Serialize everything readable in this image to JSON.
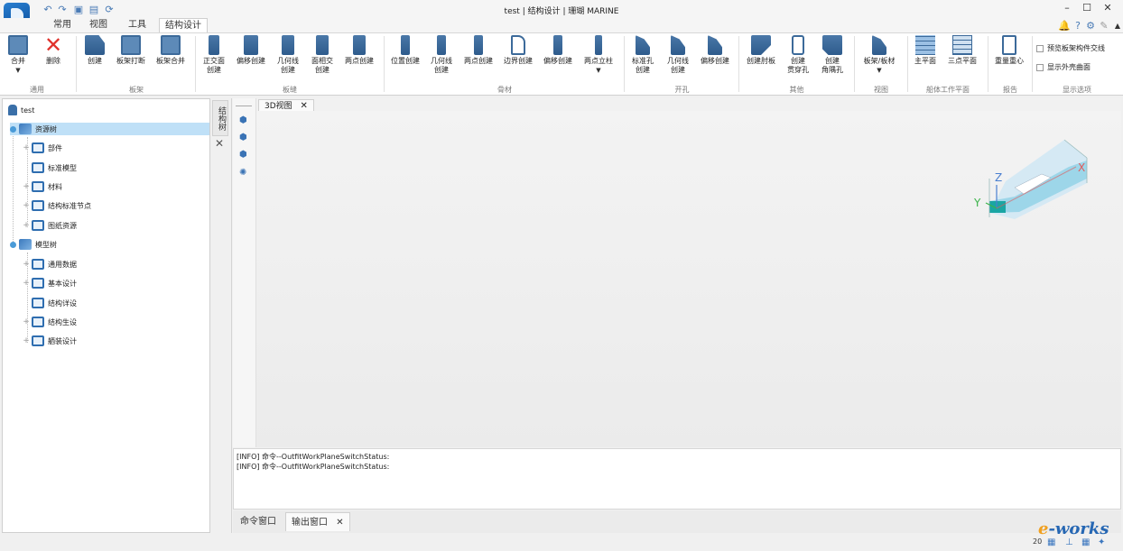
{
  "app": {
    "window_title": "test | 结构设计 | 珊瑚 MARINE"
  },
  "menu_tabs": [
    {
      "label": "常用"
    },
    {
      "label": "视图"
    },
    {
      "label": "工具"
    },
    {
      "label": "结构设计"
    }
  ],
  "ribbon": {
    "buttons": [
      {
        "label": "合并",
        "icon": "merge-icon",
        "dropdown": true
      },
      {
        "label": "删除",
        "icon": "delete-icon"
      },
      {
        "label": "创建",
        "icon": "create-panel-icon"
      },
      {
        "label": "板架打断",
        "icon": "panel-break-icon"
      },
      {
        "label": "板架合并",
        "icon": "panel-merge-icon"
      },
      {
        "label": "正交面\n创建",
        "icon": "orthogonal-create-icon"
      },
      {
        "label": "偏移创建",
        "icon": "offset-create-icon"
      },
      {
        "label": "几何线\n创建",
        "icon": "geometry-line-create-icon"
      },
      {
        "label": "面相交\n创建",
        "icon": "surface-intersect-icon"
      },
      {
        "label": "两点创建",
        "icon": "two-point-create-icon"
      },
      {
        "label": "位置创建",
        "icon": "position-create-icon"
      },
      {
        "label": "几何线\n创建",
        "icon": "geometry-line-stiffener-icon"
      },
      {
        "label": "两点创建",
        "icon": "two-point-stiffener-icon"
      },
      {
        "label": "边界创建",
        "icon": "boundary-create-icon"
      },
      {
        "label": "偏移创建",
        "icon": "offset-stiffener-icon"
      },
      {
        "label": "两点立柱",
        "icon": "two-point-pillar-icon",
        "dropdown": true
      },
      {
        "label": "标准孔\n创建",
        "icon": "standard-hole-icon"
      },
      {
        "label": "几何线\n创建",
        "icon": "geometry-hole-icon"
      },
      {
        "label": "偏移创建",
        "icon": "offset-hole-icon"
      },
      {
        "label": "创建肘板",
        "icon": "bracket-icon"
      },
      {
        "label": "创建\n贯穿孔",
        "icon": "through-hole-icon"
      },
      {
        "label": "创建\n角隅孔",
        "icon": "corner-hole-icon"
      },
      {
        "label": "板架/板材",
        "icon": "panel-plate-view-icon",
        "dropdown": true
      },
      {
        "label": "主平面",
        "icon": "main-plane-icon"
      },
      {
        "label": "三点平面",
        "icon": "three-point-plane-icon"
      },
      {
        "label": "重量重心",
        "icon": "weight-center-icon"
      }
    ],
    "groups": [
      {
        "label": "通用"
      },
      {
        "label": "板架"
      },
      {
        "label": "板缝"
      },
      {
        "label": "骨材"
      },
      {
        "label": "开孔"
      },
      {
        "label": "其他"
      },
      {
        "label": "视图"
      },
      {
        "label": "船体工作平面"
      },
      {
        "label": "报告"
      },
      {
        "label": "显示选项"
      }
    ],
    "options": [
      {
        "label": "预览板架构件交线",
        "checked": false
      },
      {
        "label": "显示外壳曲面",
        "checked": false
      }
    ]
  },
  "tree": {
    "root": "test",
    "resource_tree": {
      "label": "资源树",
      "children": [
        "部件",
        "标准模型",
        "材料",
        "结构标准节点",
        "图纸资源"
      ]
    },
    "model_tree": {
      "label": "模型树",
      "children": [
        "通用数据",
        "基本设计",
        "结构详设",
        "结构生设",
        "舾装设计"
      ]
    }
  },
  "side_tab": {
    "label": "结构树"
  },
  "view_tab": {
    "label": "3D视图"
  },
  "axes": {
    "z": "Z",
    "y": "Y",
    "x": "X"
  },
  "output": {
    "lines": [
      "[INFO] 命令--OutfitWorkPlaneSwitchStatus:",
      "[INFO] 命令--OutfitWorkPlaneSwitchStatus:"
    ]
  },
  "bottom_tabs": [
    {
      "label": "命令窗口"
    },
    {
      "label": "输出窗口"
    }
  ],
  "status": {
    "zoom_text": "20"
  },
  "watermark": {
    "prefix": "e",
    "rest": "-works"
  }
}
